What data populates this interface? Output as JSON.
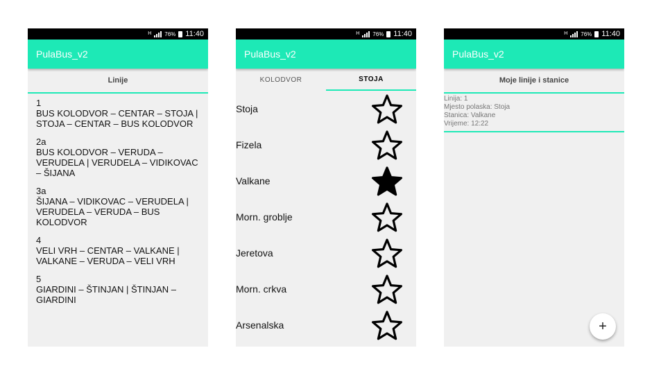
{
  "status": {
    "network": "H",
    "battery_pct": "76%",
    "time": "11:40"
  },
  "app_title": "PulaBus_v2",
  "screen1": {
    "section_title": "Linije",
    "lines": [
      {
        "num": "1",
        "route": "BUS KOLODVOR – CENTAR – STOJA | STOJA – CENTAR – BUS KOLODVOR"
      },
      {
        "num": "2a",
        "route": "BUS KOLODVOR – VERUDA – VERUDELA | VERUDELA – VIDIKOVAC – ŠIJANA"
      },
      {
        "num": "3a",
        "route": "ŠIJANA – VIDIKOVAC – VERUDELA | VERUDELA – VERUDA – BUS KOLODVOR"
      },
      {
        "num": "4",
        "route": "VELI VRH – CENTAR – VALKANE | VALKANE – VERUDA – VELI VRH"
      },
      {
        "num": "5",
        "route": "GIARDINI – ŠTINJAN | ŠTINJAN – GIARDINI"
      }
    ]
  },
  "screen2": {
    "tabs": [
      {
        "label": "KOLODVOR",
        "active": false
      },
      {
        "label": "STOJA",
        "active": true
      }
    ],
    "stations": [
      {
        "name": "Stoja",
        "favorite": false
      },
      {
        "name": "Fizela",
        "favorite": false
      },
      {
        "name": "Valkane",
        "favorite": true
      },
      {
        "name": "Morn. groblje",
        "favorite": false
      },
      {
        "name": "Jeretova",
        "favorite": false
      },
      {
        "name": "Morn. crkva",
        "favorite": false
      },
      {
        "name": "Arsenalska",
        "favorite": false
      }
    ]
  },
  "screen3": {
    "section_title": "Moje linije i stanice",
    "favorites": [
      {
        "line": "Linija: 1",
        "origin": "Mjesto polaska: Stoja",
        "station": "Stanica: Valkane",
        "time": "Vrijeme: 12:22"
      }
    ],
    "fab_label": "+"
  },
  "colors": {
    "accent": "#1de9b6",
    "status_bar": "#000000",
    "background": "#f0f0f0"
  }
}
